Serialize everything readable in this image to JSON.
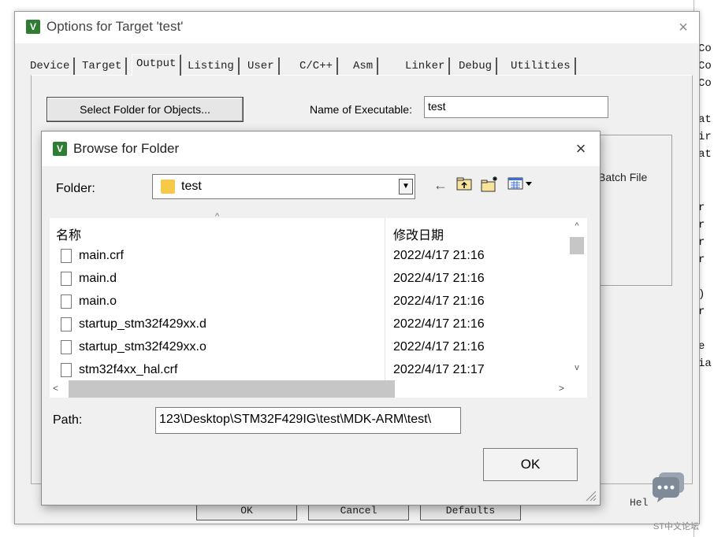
{
  "background_code": [
    "Co",
    "Co",
    "Co",
    "at",
    "ir",
    "at",
    "r",
    "r",
    "r",
    "r",
    ")",
    "r",
    "e",
    "ia"
  ],
  "outer": {
    "title": "Options for Target 'test'",
    "app_icon": "V",
    "close_glyph": "×",
    "tabs": [
      "Device",
      "Target",
      "Output",
      "Listing",
      "User",
      "C/C++",
      "Asm",
      "Linker",
      "Debug",
      "Utilities"
    ],
    "active_tab": "Output",
    "select_folder_label": "Select Folder for Objects...",
    "exe_label": "Name of Executable:",
    "exe_value": "test",
    "batch_label": "Batch File",
    "buttons": [
      "OK",
      "Cancel",
      "Defaults"
    ],
    "help_label": "Hel"
  },
  "browse": {
    "title": "Browse for Folder",
    "app_icon": "V",
    "close_glyph": "×",
    "folder_label": "Folder:",
    "folder_value": "test",
    "toolbar_icons": [
      "back-arrow-icon",
      "up-folder-icon",
      "new-folder-icon",
      "view-menu-icon"
    ],
    "columns": {
      "name": "名称",
      "date": "修改日期"
    },
    "files": [
      {
        "name": "main.crf",
        "date": "2022/4/17 21:16"
      },
      {
        "name": "main.d",
        "date": "2022/4/17 21:16"
      },
      {
        "name": "main.o",
        "date": "2022/4/17 21:16"
      },
      {
        "name": "startup_stm32f429xx.d",
        "date": "2022/4/17 21:16"
      },
      {
        "name": "startup_stm32f429xx.o",
        "date": "2022/4/17 21:16"
      },
      {
        "name": "stm32f4xx_hal.crf",
        "date": "2022/4/17 21:17"
      }
    ],
    "path_label": "Path:",
    "path_value": "123\\Desktop\\STM32F429IG\\test\\MDK-ARM\\test\\",
    "ok_label": "OK"
  },
  "watermark": "ST中文论坛",
  "colors": {
    "accent_green": "#2e7d32",
    "folder_yellow": "#f7c948",
    "scroll_thumb": "#c6c6c6"
  }
}
